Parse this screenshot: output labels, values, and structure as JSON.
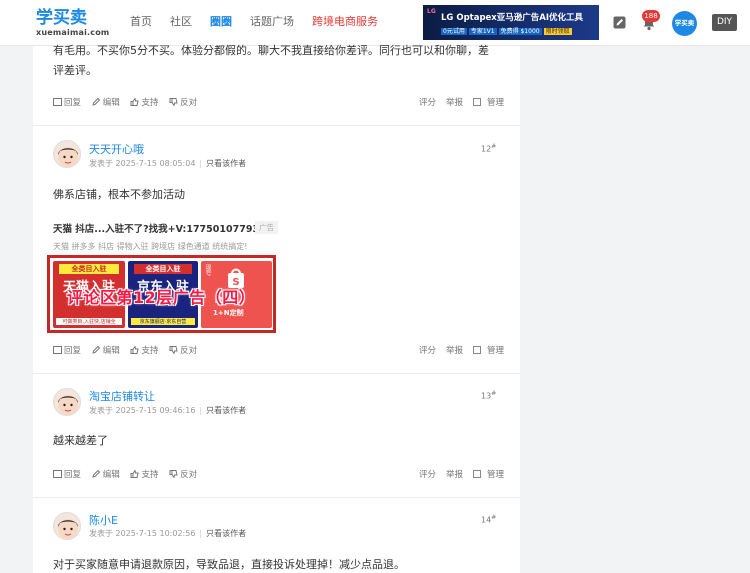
{
  "header": {
    "logo_text": "学买卖",
    "logo_sub": "xuemaimai.com",
    "nav": [
      "首页",
      "社区",
      "圈圈",
      "话题广场",
      "跨境电商服务"
    ],
    "banner": {
      "brand": "LG",
      "title": "LG Optapex亚马逊广告AI优化工具",
      "tags": [
        "0元试用",
        "专家1V1",
        "免费得 $1000",
        "限时领取"
      ]
    },
    "notification_count": "188",
    "avatar_label": "学买卖",
    "diy_label": "DIY"
  },
  "comments": [
    {
      "text_lines": [
        "有毛用。不买你5分不买。体验分都假的。聊大不我直接给你差评。同行也可以和你聊，差",
        "评差评。"
      ],
      "actions": {
        "reply": "回复",
        "edit": "编辑",
        "support": "支持",
        "oppose": "反对"
      },
      "right_actions": {
        "rate": "评分",
        "report": "举报",
        "manage": "管理"
      }
    },
    {
      "name": "天天开心哦",
      "time": "发表于 2025-7-15 08:05:04",
      "only_author": "只看该作者",
      "floor": "12",
      "text": "佛系店铺，根本不参加活动",
      "ad": {
        "title": "天猫 抖店...入驻不了?找我+V:17750107793",
        "tag": "广告",
        "desc": "天猫 拼多多 抖店 得物入驻 跨境店 绿色通道 统统搞定!",
        "overlay": "评论区第12层广告（四）",
        "tiles": [
          {
            "head": "全类目入驻",
            "big": "天猫入驻",
            "foot": "可做类目,入驻快,店铺全"
          },
          {
            "head": "全类目入驻",
            "big": "京东入驻",
            "foot": "京东旗舰店·京东自营"
          },
          {
            "head": "跨境店",
            "big": "1+N定制",
            "foot": "现号"
          }
        ]
      },
      "actions": {
        "reply": "回复",
        "edit": "编辑",
        "support": "支持",
        "oppose": "反对"
      },
      "right_actions": {
        "rate": "评分",
        "report": "举报",
        "manage": "管理"
      }
    },
    {
      "name": "淘宝店铺转让",
      "time": "发表于 2025-7-15 09:46:16",
      "only_author": "只看该作者",
      "floor": "13",
      "text": "越来越差了",
      "actions": {
        "reply": "回复",
        "edit": "编辑",
        "support": "支持",
        "oppose": "反对"
      },
      "right_actions": {
        "rate": "评分",
        "report": "举报",
        "manage": "管理"
      }
    },
    {
      "name": "陈小E",
      "time": "发表于 2025-7-15 10:02:56",
      "only_author": "只看该作者",
      "floor": "14",
      "text": "对于买家随意申请退款原因，导致品退，直接投诉处理掉！减少点品退。"
    }
  ],
  "colors": {
    "link": "#1e88e5",
    "accent_red": "#e53935",
    "ad_border": "#c62828"
  }
}
